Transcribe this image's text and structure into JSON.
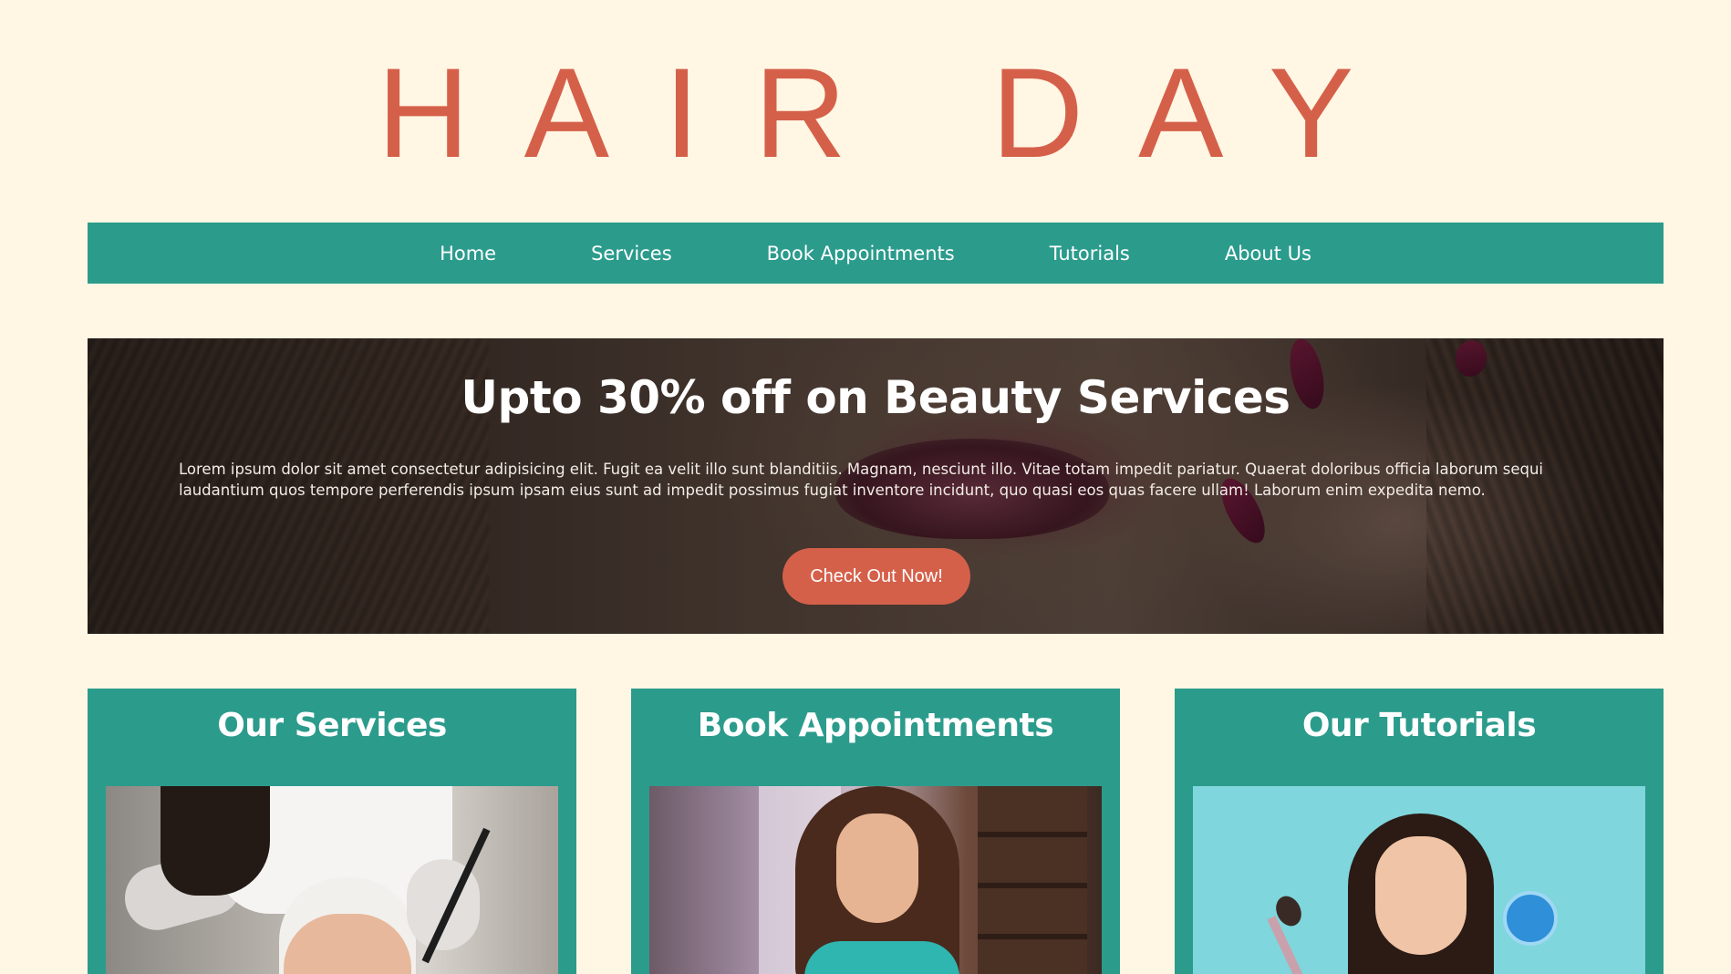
{
  "brand": {
    "logo_text": "HAIR DAY",
    "primary_color": "#d5604a",
    "accent_color": "#2b9b8c",
    "background_color": "#fff6e3"
  },
  "nav": {
    "items": [
      {
        "label": "Home"
      },
      {
        "label": "Services"
      },
      {
        "label": "Book Appointments"
      },
      {
        "label": "Tutorials"
      },
      {
        "label": "About Us"
      }
    ]
  },
  "hero": {
    "title": "Upto 30% off on Beauty Services",
    "body": "Lorem ipsum dolor sit amet consectetur adipisicing elit. Fugit ea velit illo sunt blanditiis. Magnam, nesciunt illo. Vitae totam impedit pariatur. Quaerat doloribus officia laborum sequi laudantium quos tempore perferendis ipsum ipsam eius sunt ad impedit possimus fugiat inventore incidunt, quo quasi eos quas facere ullam! Laborum enim expedita nemo.",
    "cta_label": "Check Out Now!"
  },
  "cards": [
    {
      "title": "Our Services"
    },
    {
      "title": "Book Appointments"
    },
    {
      "title": "Our Tutorials"
    }
  ]
}
